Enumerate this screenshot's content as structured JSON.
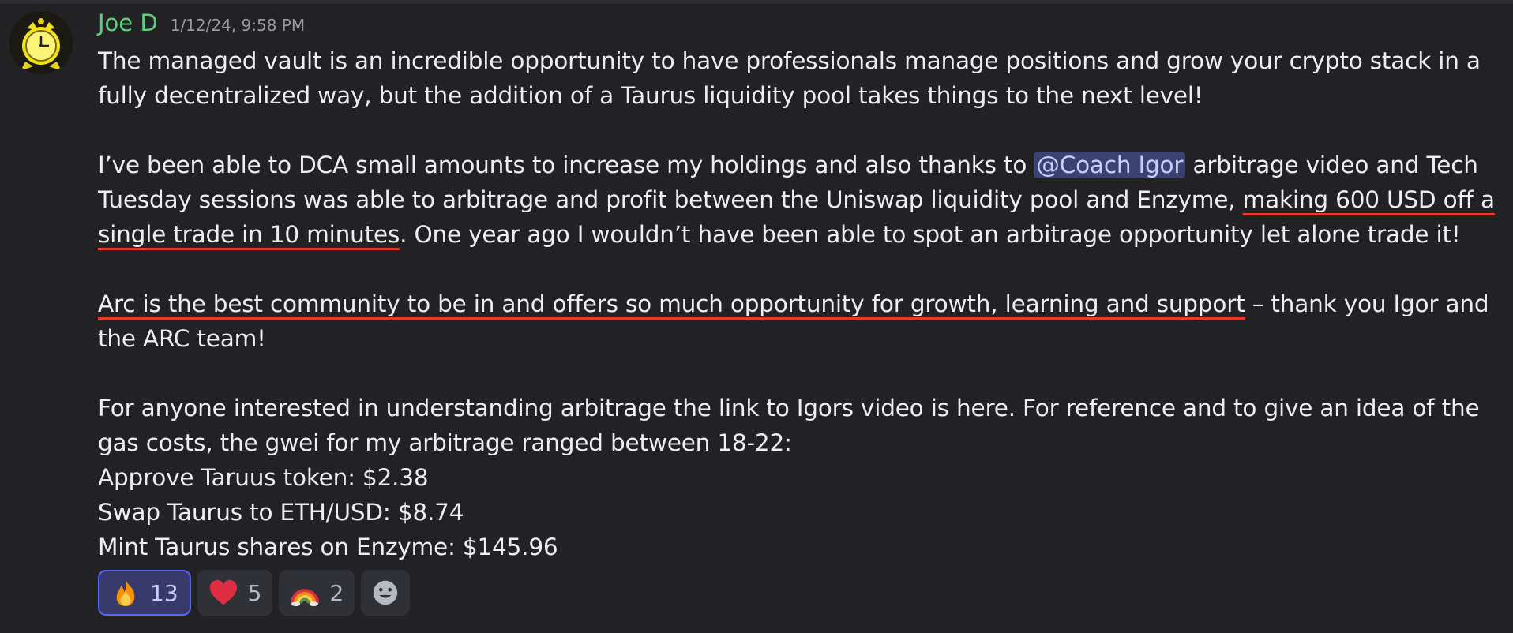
{
  "message": {
    "author": "Joe D",
    "timestamp": "1/12/24, 9:58 PM",
    "p1": "The managed vault is an incredible opportunity to have professionals manage positions and grow your crypto stack in a fully decentralized way, but the addition of a Taurus liquidity pool takes things to the next level!",
    "p2_pre": "I’ve been able to DCA small amounts to increase my holdings and also thanks to ",
    "mention": "@Coach Igor",
    "p2_mid": " arbitrage  video and Tech Tuesday sessions was able to arbitrage and profit between the Uniswap liquidity pool and Enzyme, ",
    "p2_highlight": "making 600 USD off a single trade in 10 minutes",
    "p2_post": ". One year ago I wouldn’t have been able to spot an arbitrage opportunity let alone trade it!",
    "p3_highlight": "Arc is the best community to be in and offers so much opportunity for growth, learning and support",
    "p3_post": " – thank you Igor and the ARC team!",
    "p4": "For anyone interested in understanding arbitrage the link to Igors video is here. For reference and to give an idea of the gas costs, the gwei for my arbitrage ranged between 18-22:",
    "line_approve": "Approve Taruus token: $2.38",
    "line_swap": "Swap Taurus to ETH/USD: $8.74",
    "line_mint": "Mint Taurus shares on Enzyme: $145.96"
  },
  "reactions": [
    {
      "emoji": "fire-emoji",
      "count": "13",
      "active": true
    },
    {
      "emoji": "red-heart-emoji",
      "count": "5",
      "active": false
    },
    {
      "emoji": "rainbow-emoji",
      "count": "2",
      "active": false
    },
    {
      "emoji": "add-reaction-icon",
      "count": "",
      "active": false
    }
  ],
  "colors": {
    "background": "#222225",
    "username": "#5ccf7a",
    "mention_bg": "#3c4270",
    "highlight_underline": "#e8392b",
    "active_reaction_border": "#5865f2"
  }
}
